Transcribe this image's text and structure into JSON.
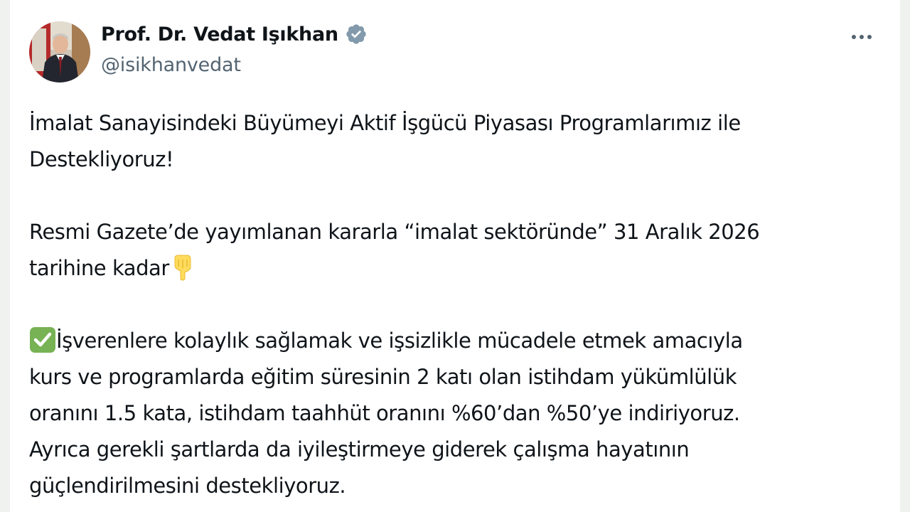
{
  "tweet": {
    "author": {
      "display_name": "Prof. Dr. Vedat Işıkhan",
      "handle": "@isikhanvedat",
      "verified_icon": "verified-badge-icon",
      "avatar": "profile-photo"
    },
    "more_icon": "more-options-icon",
    "paragraphs": {
      "p1_line1": "İmalat Sanayisindeki Büyümeyi Aktif İşgücü Piyasası Programlarımız ile",
      "p1_line2": "Destekliyoruz!",
      "p2_line1": "Resmi Gazete’de yayımlanan kararla “imalat sektöründe” 31 Aralık 2026",
      "p2_line2": "tarihine kadar",
      "p3_line1": "İşverenlere kolaylık sağlamak ve işsizlikle mücadele etmek amacıyla",
      "p3_line2": "kurs ve programlarda eğitim süresinin 2 katı olan istihdam yükümlülük",
      "p3_line3": "oranını 1.5 kata, istihdam taahhüt oranını %60’dan %50’ye indiriyoruz.",
      "p3_line4": "Ayrıca gerekli şartlarda da iyileştirmeye giderek çalışma hayatının",
      "p3_line5": "güçlendirilmesini destekliyoruz."
    },
    "emoji": {
      "pointing_down": "backhand-index-pointing-down-icon",
      "check_mark": "check-mark-button-icon"
    },
    "colors": {
      "text": "#0f1419",
      "secondary_text": "#536471",
      "verified_badge": "#829aab",
      "check_emoji": "#77b255",
      "hand_emoji": "#ffdc5d"
    }
  }
}
